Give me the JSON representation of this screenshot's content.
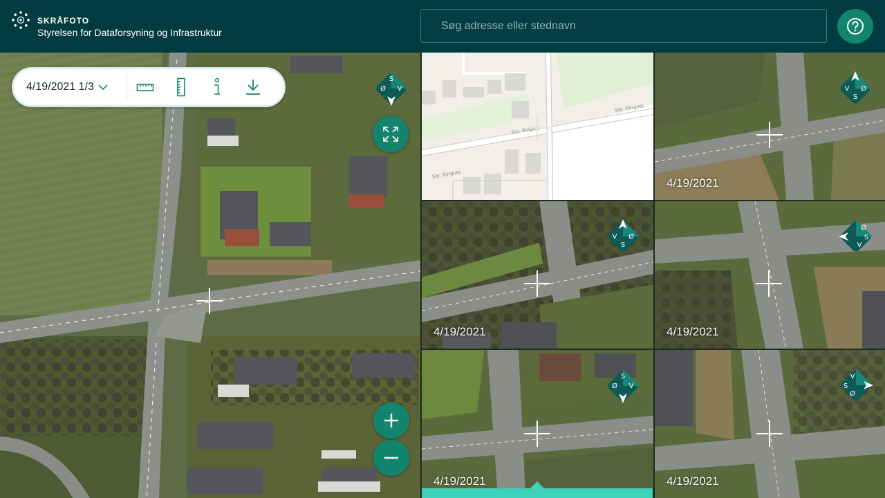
{
  "header": {
    "app_title": "SKRÅFOTO",
    "org_name": "Styrelsen for Dataforsyning og Infrastruktur",
    "search_placeholder": "Søg adresse eller stednavn",
    "help_icon": "question-circle-icon"
  },
  "toolbar": {
    "date_selector": "4/19/2021 1/3",
    "icons": [
      "ruler-horizontal-icon",
      "ruler-vertical-icon",
      "info-icon",
      "download-icon"
    ]
  },
  "main_map": {
    "compass_letters": [
      "S",
      "Ø",
      "V"
    ],
    "controls": [
      "fullscreen-icon",
      "zoom-in-icon",
      "zoom-out-icon"
    ]
  },
  "basemap_tile": {
    "street_label_1": "Sdr. Ringvej",
    "street_label_2": "Sdr. Ringvej",
    "street_label_3": "Sdr. Ringvej"
  },
  "thumbnails": [
    {
      "date": "4/19/2021",
      "compass": [
        "S",
        "V",
        "Ø"
      ]
    },
    {
      "date": "4/19/2021",
      "compass": [
        "V",
        "S",
        "Ø"
      ]
    },
    {
      "date": "4/19/2021",
      "compass": [
        "Ø",
        "S",
        "V"
      ]
    },
    {
      "date": "4/19/2021",
      "compass": [
        "Ø",
        "S",
        "V"
      ]
    },
    {
      "date": "4/19/2021",
      "compass": [
        "V",
        "S",
        "Ø"
      ]
    }
  ],
  "colors": {
    "header_bg": "#003b40",
    "accent_green": "#13856f",
    "active_bar": "#3dd2b9"
  }
}
